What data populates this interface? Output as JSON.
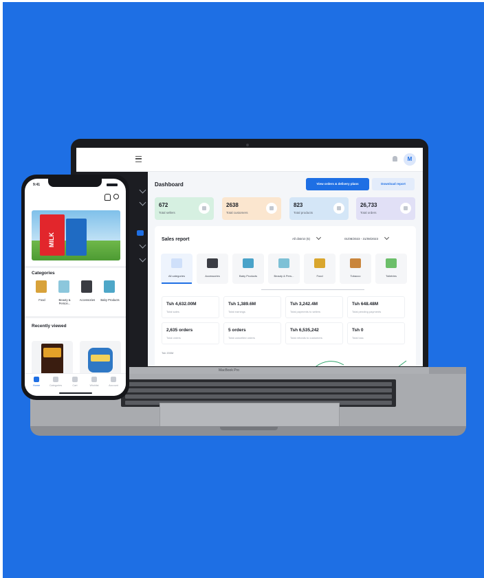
{
  "colors": {
    "background": "#1e6fe4",
    "accent": "#1e6fe4"
  },
  "laptop": {
    "brand_label": "MacBook Pro",
    "avatar_initial": "M",
    "dashboard": {
      "title": "Dashboard",
      "primary_button": "View orders & delivery plans",
      "secondary_button": "Download report",
      "stats": [
        {
          "value": "672",
          "label": "Total sellers",
          "color": "#d6f0e1"
        },
        {
          "value": "2638",
          "label": "Total customers",
          "color": "#fbe6cf"
        },
        {
          "value": "823",
          "label": "Total products",
          "color": "#d4e6f7"
        },
        {
          "value": "26,733",
          "label": "Total orders",
          "color": "#e1e0f6"
        }
      ],
      "sales_report": {
        "title": "Sales report",
        "district_filter": "All district (5)",
        "date_range": "01/08/2023 - 31/08/2023",
        "categories": [
          {
            "label": "All categories",
            "icon": "grid-icon"
          },
          {
            "label": "Accessories",
            "icon": "accessories-icon"
          },
          {
            "label": "Baby Products",
            "icon": "baby-products-icon"
          },
          {
            "label": "Beauty & Pers...",
            "icon": "beauty-icon"
          },
          {
            "label": "Food",
            "icon": "food-icon"
          },
          {
            "label": "Tobacco",
            "icon": "tobacco-icon"
          },
          {
            "label": "Toiletries",
            "icon": "toiletries-icon"
          }
        ],
        "kpis": [
          {
            "value": "Tsh 4,632.00M",
            "label": "Total sales"
          },
          {
            "value": "Tsh 1,389.6M",
            "label": "Total earnings"
          },
          {
            "value": "Tsh 3,242.4M",
            "label": "Total payments to sellers"
          },
          {
            "value": "Tsh 648.48M",
            "label": "Total pending payments"
          },
          {
            "value": "2,635 orders",
            "label": "Total orders"
          },
          {
            "value": "5 orders",
            "label": "Total cancelled orders"
          },
          {
            "value": "Tsh 6,535,242",
            "label": "Total refunds to customers"
          },
          {
            "value": "Tsh 0",
            "label": "Total loss"
          }
        ],
        "chart_axis_label": "Tsh 200M"
      }
    }
  },
  "phone": {
    "time": "9:41",
    "banner_text": "MILK",
    "categories_title": "Categories",
    "categories": [
      {
        "label": "Food"
      },
      {
        "label": "Beauty & Person..."
      },
      {
        "label": "Accessories"
      },
      {
        "label": "Baby Products"
      }
    ],
    "recent_title": "Recently viewed",
    "tabs": [
      {
        "label": "Home",
        "active": true
      },
      {
        "label": "Categories",
        "active": false
      },
      {
        "label": "Cart",
        "active": false
      },
      {
        "label": "Wishlist",
        "active": false
      },
      {
        "label": "Account",
        "active": false
      }
    ]
  }
}
